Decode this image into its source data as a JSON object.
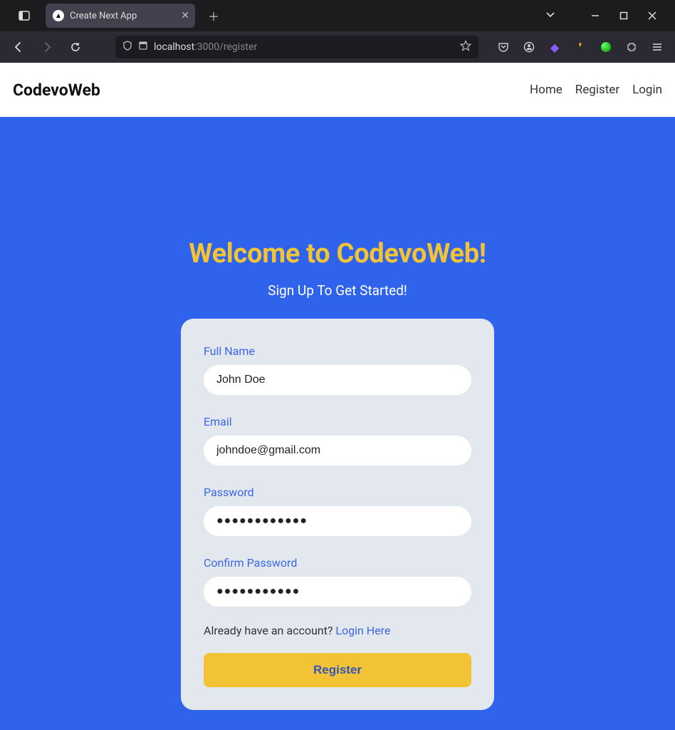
{
  "browser": {
    "tab_title": "Create Next App",
    "url_host": "localhost",
    "url_path": ":3000/register"
  },
  "header": {
    "brand": "CodevoWeb",
    "nav": {
      "home": "Home",
      "register": "Register",
      "login": "Login"
    }
  },
  "hero": {
    "title": "Welcome to CodevoWeb!",
    "subtitle": "Sign Up To Get Started!"
  },
  "form": {
    "name_label": "Full Name",
    "name_value": "John Doe",
    "email_label": "Email",
    "email_value": "johndoe@gmail.com",
    "password_label": "Password",
    "password_value": "●●●●●●●●●●●●",
    "confirm_label": "Confirm Password",
    "confirm_value": "●●●●●●●●●●●",
    "login_prompt": "Already have an account? ",
    "login_link": "Login Here",
    "submit_label": "Register"
  }
}
